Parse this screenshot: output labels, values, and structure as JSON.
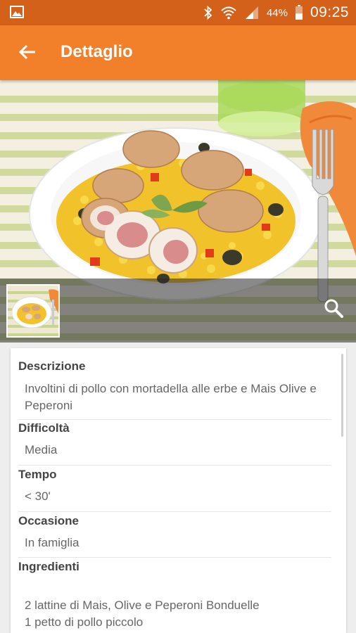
{
  "status_bar": {
    "battery_percent": "44%",
    "time": "09:25",
    "icons": [
      "image-icon",
      "bluetooth-icon",
      "wifi-icon",
      "signal-icon",
      "battery-icon"
    ]
  },
  "app_bar": {
    "title": "Dettaglio",
    "back_icon": "arrow-back-icon"
  },
  "hero": {
    "zoom_icon": "zoom-icon"
  },
  "details": {
    "description": {
      "label": "Descrizione",
      "value": "Involtini di pollo con mortadella alle erbe e Mais Olive e Peperoni"
    },
    "difficulty": {
      "label": "Difficoltà",
      "value": "Media"
    },
    "time": {
      "label": "Tempo",
      "value": "< 30'"
    },
    "occasion": {
      "label": "Occasione",
      "value": "In famiglia"
    },
    "ingredients": {
      "label": "Ingredienti",
      "items": [
        "2 lattine di Mais, Olive e Peperoni Bonduelle",
        "1 petto di pollo piccolo"
      ]
    }
  },
  "colors": {
    "status_bar": "#d4611a",
    "app_bar": "#f2802a"
  }
}
